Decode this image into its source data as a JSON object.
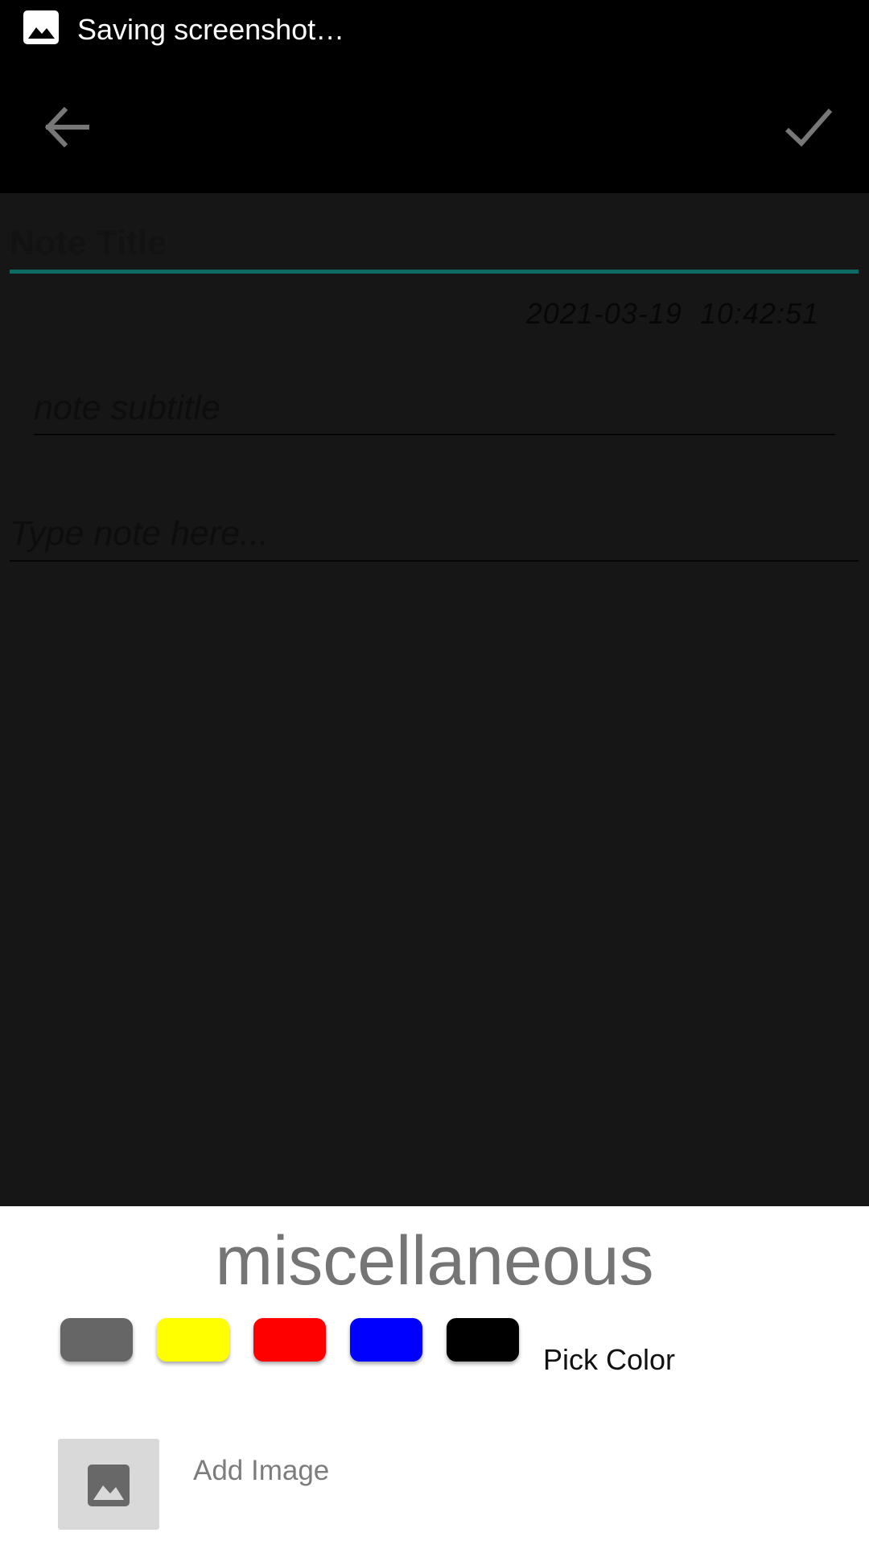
{
  "status_bar": {
    "notification_text": "Saving screenshot…",
    "icon": "image-icon"
  },
  "toolbar": {
    "back_icon": "arrow-back-icon",
    "confirm_icon": "check-icon"
  },
  "editor": {
    "title_placeholder": "Note Title",
    "datetime": "2021-03-19  10:42:51",
    "subtitle_placeholder": "note subtitle",
    "note_placeholder": "Type note here..."
  },
  "bottom_sheet": {
    "category": "miscellaneous",
    "colors": [
      "#666666",
      "#FFFF00",
      "#FF0000",
      "#0000FF",
      "#000000"
    ],
    "pick_color_label": "Pick Color",
    "add_image_label": "Add Image",
    "add_image_icon": "image-icon"
  },
  "theme": {
    "accent": "#0D6B64",
    "background": "#161616",
    "sheet": "#FFFFFF"
  }
}
